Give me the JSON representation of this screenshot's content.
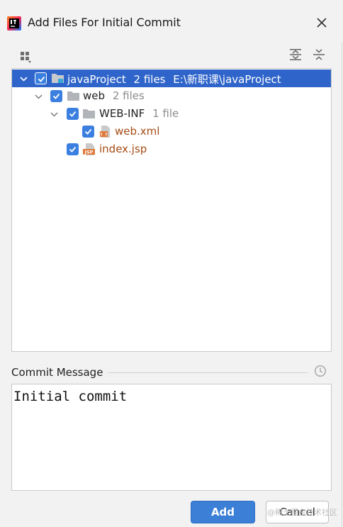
{
  "window": {
    "title": "Add Files For Initial Commit",
    "app_icon": "intellij-idea-icon",
    "close_icon": "close-icon"
  },
  "toolbar": {
    "group_by_icon": "group-by-icon",
    "expand_all_icon": "expand-all-icon",
    "collapse_all_icon": "collapse-all-icon"
  },
  "tree": {
    "root": {
      "name": "javaProject",
      "count": "2 files",
      "path": "E:\\新职课\\javaProject",
      "checked": true,
      "selected": true,
      "expanded": true
    },
    "web": {
      "name": "web",
      "count": "2 files",
      "checked": true,
      "expanded": true
    },
    "webinf": {
      "name": "WEB-INF",
      "count": "1 file",
      "checked": true,
      "expanded": true
    },
    "webxml": {
      "name": "web.xml",
      "checked": true,
      "icon": "xml-file-icon"
    },
    "indexjsp": {
      "name": "index.jsp",
      "checked": true,
      "icon": "jsp-file-icon",
      "icon_text": "JSP"
    }
  },
  "commit": {
    "label": "Commit Message",
    "message": "Initial commit",
    "history_icon": "history-clock-icon"
  },
  "buttons": {
    "add": "Add",
    "cancel": "Cancel"
  },
  "watermark": "@稀土掘金技术社区",
  "colors": {
    "selection": "#2f65ca",
    "checkbox": "#3b80e0",
    "file_label": "#a64b14",
    "add_button": "#3b7fd6",
    "muted_text": "#8c8c8c"
  }
}
